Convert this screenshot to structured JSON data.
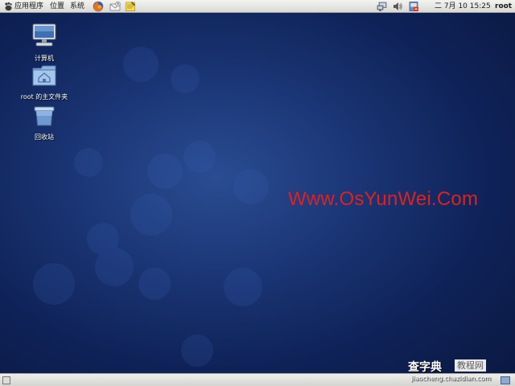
{
  "top_panel": {
    "menus": {
      "applications": "应用程序",
      "places": "位置",
      "system": "系统"
    },
    "launchers": [
      {
        "icon": "firefox-icon"
      },
      {
        "icon": "mail-icon"
      },
      {
        "icon": "notes-icon"
      }
    ],
    "tray_icons": [
      "network-icon",
      "volume-icon",
      "update-icon"
    ],
    "clock": "二 7月 10 15:25",
    "user": "root"
  },
  "desktop": {
    "icons": [
      {
        "label": "计算机",
        "icon": "computer-icon"
      },
      {
        "label": "root 的主文件夹",
        "icon": "home-folder-icon"
      },
      {
        "label": "回收站",
        "icon": "trash-icon"
      }
    ],
    "watermark": "Www.OsYunWei.Com"
  },
  "corner_logo": {
    "main": "查字典",
    "sub": "教程网",
    "url": "jiaocheng.chazidian.com"
  },
  "colors": {
    "desktop_bg": "#1a3574",
    "watermark": "#e2201e",
    "panel_bg": "#e6e6e3"
  }
}
